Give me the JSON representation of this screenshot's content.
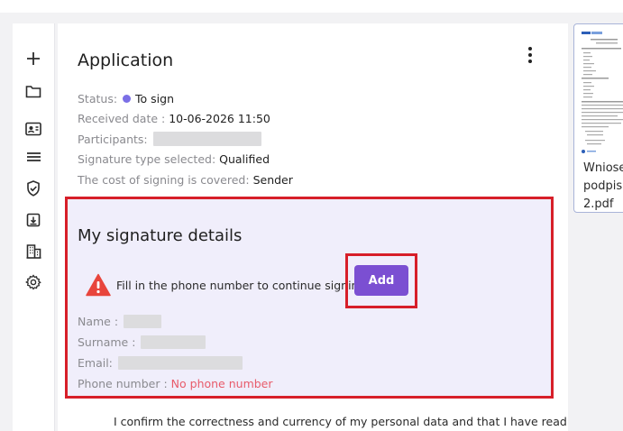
{
  "sidebar": {
    "items": [
      {
        "icon": "plus-icon"
      },
      {
        "icon": "folder-icon"
      },
      {
        "icon": "contact-card-icon"
      },
      {
        "icon": "list-icon"
      },
      {
        "icon": "shield-check-icon"
      },
      {
        "icon": "archive-box-icon"
      },
      {
        "icon": "building-icon"
      },
      {
        "icon": "gear-icon"
      }
    ]
  },
  "application": {
    "title": "Application",
    "status_label": "Status:",
    "status_value": "To sign",
    "status_color": "#7b6fe6",
    "received_label": "Received date :",
    "received_value": "10-06-2026 11:50",
    "participants_label": "Participants:",
    "signature_type_label": "Signature type selected:",
    "signature_type_value": "Qualified",
    "cost_label": "The cost of signing is covered:",
    "cost_value": "Sender"
  },
  "signature_details": {
    "title": "My signature details",
    "warning_text": "Fill in the phone number to continue signing",
    "add_button_label": "Add",
    "name_label": "Name :",
    "surname_label": "Surname :",
    "email_label": "Email:",
    "phone_label": "Phone number :",
    "phone_value": "No phone number"
  },
  "confirmation_text": "I confirm the correctness and currency of my personal data and that I have read the",
  "document": {
    "name_line1": "Wniose",
    "name_line2": "podpis .",
    "name_line3": "2.pdf"
  },
  "colors": {
    "accent": "#7b4fd2",
    "highlight_border": "#d71f29",
    "warning": "#e8453c",
    "error_text": "#e85b6a"
  }
}
